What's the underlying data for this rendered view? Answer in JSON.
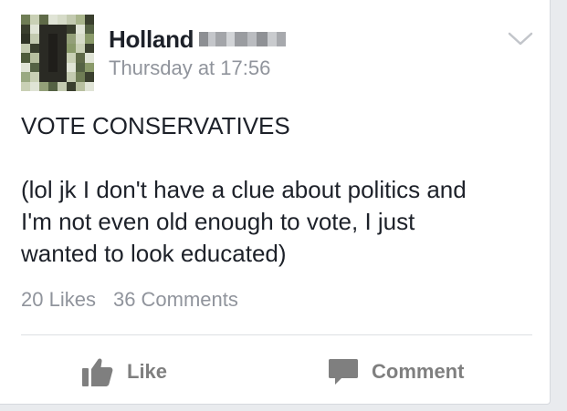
{
  "post": {
    "author": {
      "first_name": "Holland",
      "surname_redacted": true
    },
    "timestamp": "Thursday at 17:56",
    "text_lines": [
      "VOTE CONSERVATIVES",
      "(lol jk I don't have a clue about politics and",
      "I'm not even old enough to vote, I just",
      "wanted to look educated)"
    ],
    "likes_label": "20 Likes",
    "comments_label": "36 Comments"
  },
  "actions": {
    "like_label": "Like",
    "comment_label": "Comment"
  },
  "colors": {
    "text": "#1d2129",
    "meta": "#90949c",
    "action": "#7f7f7f",
    "divider": "#dddfe2"
  },
  "icons": {
    "menu": "chevron-down-icon",
    "like": "thumbs-up-icon",
    "comment": "speech-bubble-icon"
  }
}
